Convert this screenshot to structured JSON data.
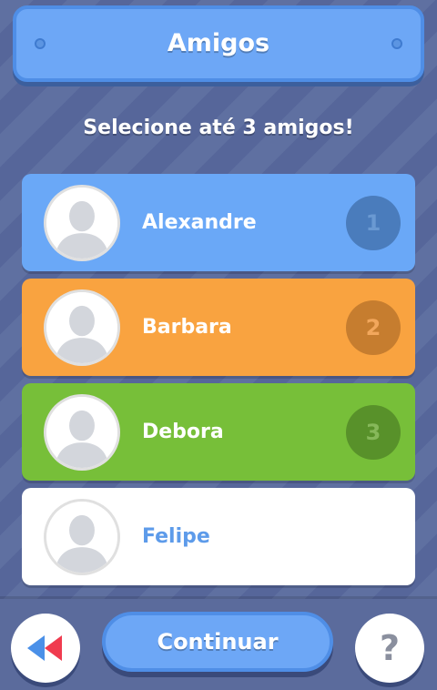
{
  "header": {
    "title": "Amigos"
  },
  "instruction": "Selecione até 3 amigos!",
  "friends": [
    {
      "name": "Alexandre",
      "order": "1",
      "selected": true,
      "color": "#6aa8f7",
      "badge_color": "#4a7cbc",
      "badge_text_color": "#6a99d2",
      "name_color": "#ffffff"
    },
    {
      "name": "Barbara",
      "order": "2",
      "selected": true,
      "color": "#f9a340",
      "badge_color": "#c67d2f",
      "badge_text_color": "#f2a75c",
      "name_color": "#ffffff"
    },
    {
      "name": "Debora",
      "order": "3",
      "selected": true,
      "color": "#77bf39",
      "badge_color": "#58912a",
      "badge_text_color": "#86b85a",
      "name_color": "#ffffff"
    },
    {
      "name": "Felipe",
      "order": "",
      "selected": false,
      "color": "#ffffff",
      "badge_color": "",
      "badge_text_color": "",
      "name_color": "#5d9bea"
    }
  ],
  "footer": {
    "back_icon": "rewind-icon",
    "continue_label": "Continuar",
    "help_label": "?"
  }
}
